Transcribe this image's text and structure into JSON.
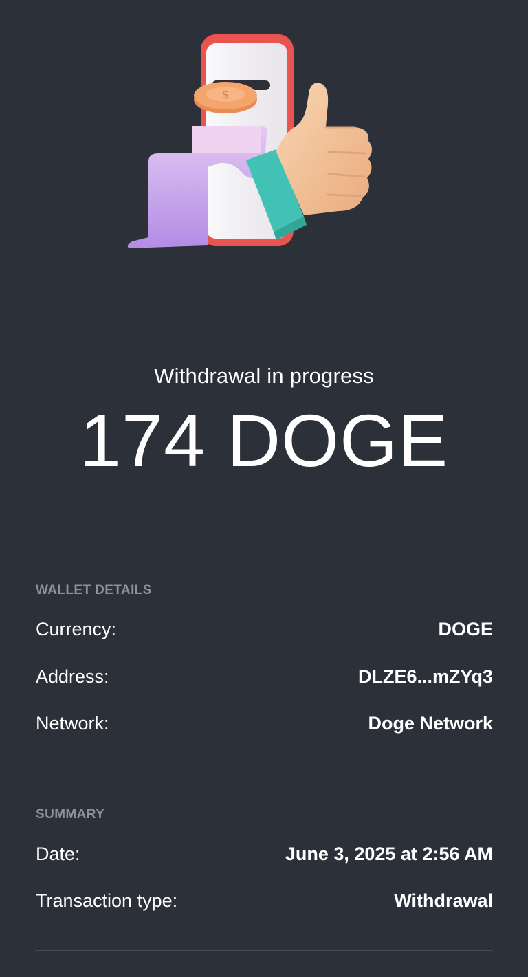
{
  "status_text": "Withdrawal in progress",
  "amount": "174 DOGE",
  "wallet_details": {
    "title": "WALLET DETAILS",
    "rows": [
      {
        "label": "Currency:",
        "value": "DOGE"
      },
      {
        "label": "Address:",
        "value": "DLZE6...mZYq3"
      },
      {
        "label": "Network:",
        "value": "Doge Network"
      }
    ]
  },
  "summary": {
    "title": "SUMMARY",
    "rows": [
      {
        "label": "Date:",
        "value": "June 3, 2025 at 2:56 AM"
      },
      {
        "label": "Transaction type:",
        "value": "Withdrawal"
      }
    ]
  },
  "illustration": {
    "icon": "phone-receipt-coin-thumbs-up-illustration",
    "colors": {
      "background": "#2b3039",
      "phone": "#e9554e",
      "receipt": "#c9a7ee",
      "coin": "#f2a36a",
      "cuff": "#42c2b5",
      "hand": "#f6c9a0"
    }
  }
}
